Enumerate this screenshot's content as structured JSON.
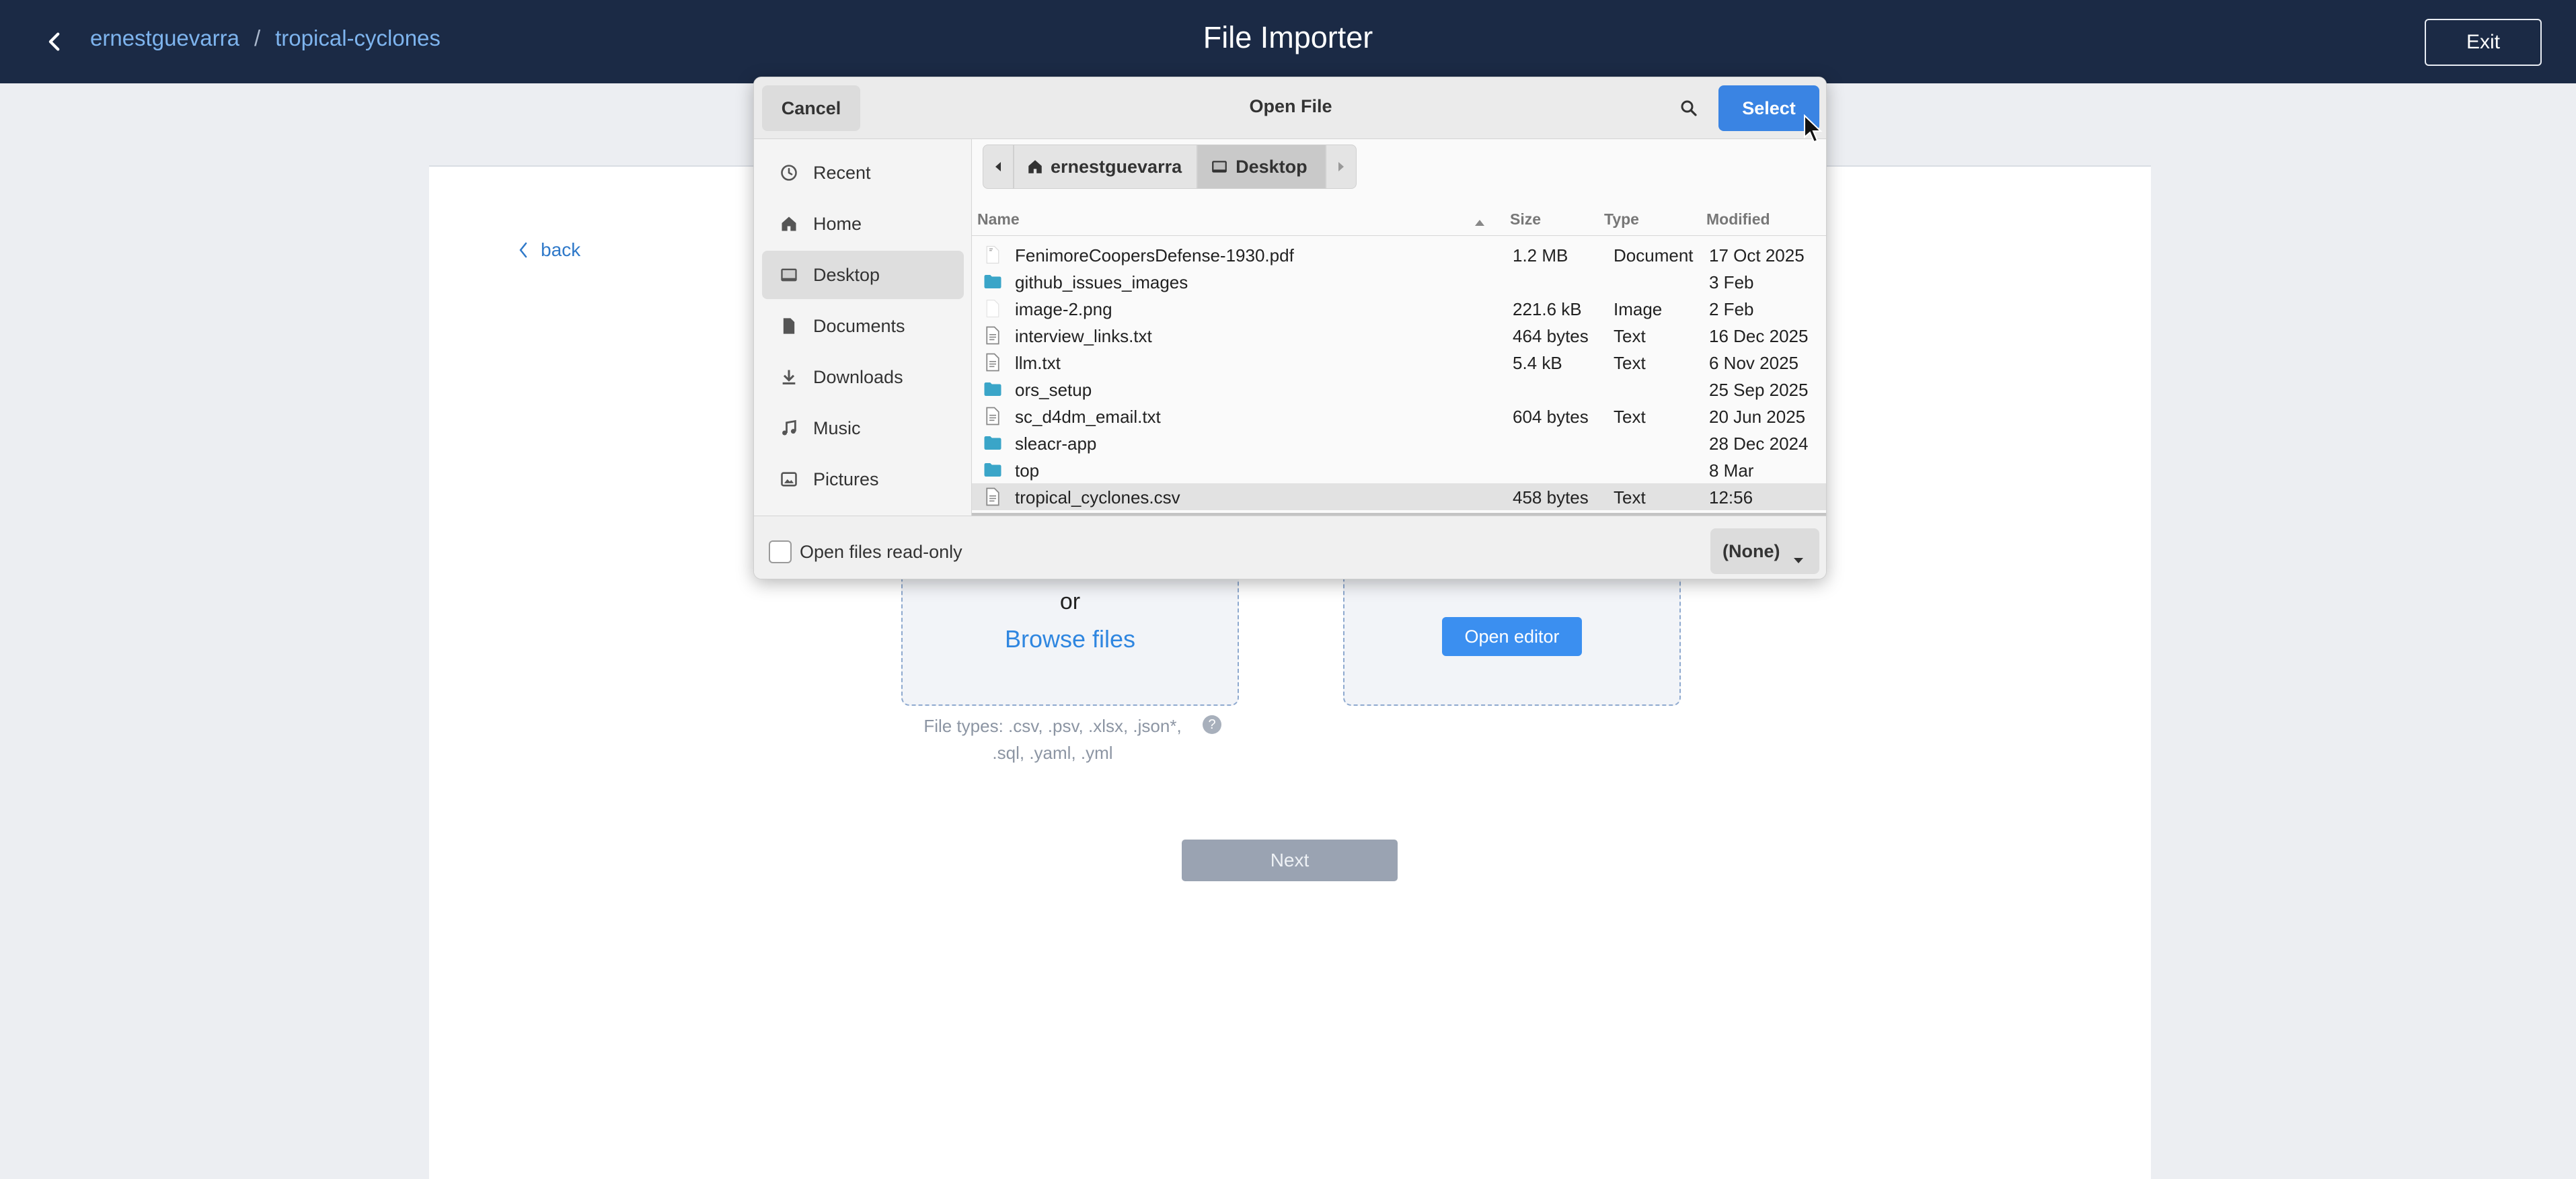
{
  "header": {
    "breadcrumb": [
      "ernestguevarra",
      "tropical-cyclones"
    ],
    "breadcrumb_sep": "/",
    "title": "File Importer",
    "exit_label": "Exit"
  },
  "page": {
    "back_label": "back",
    "or_label": "or",
    "browse_label": "Browse files",
    "open_editor_label": "Open editor",
    "file_types_line1": "File types: .csv, .psv, .xlsx, .json*,",
    "file_types_line2": ".sql, .yaml, .yml",
    "help_glyph": "?",
    "next_label": "Next"
  },
  "dialog": {
    "title": "Open File",
    "cancel_label": "Cancel",
    "select_label": "Select",
    "places": [
      {
        "label": "Recent",
        "icon": "clock-icon"
      },
      {
        "label": "Home",
        "icon": "home-icon"
      },
      {
        "label": "Desktop",
        "icon": "desktop-icon",
        "active": true
      },
      {
        "label": "Documents",
        "icon": "document-icon"
      },
      {
        "label": "Downloads",
        "icon": "download-icon"
      },
      {
        "label": "Music",
        "icon": "music-icon"
      },
      {
        "label": "Pictures",
        "icon": "pictures-icon"
      }
    ],
    "path": [
      "ernestguevarra",
      "Desktop"
    ],
    "columns": {
      "name": "Name",
      "size": "Size",
      "type": "Type",
      "modified": "Modified"
    },
    "files": [
      {
        "name": "FenimoreCoopersDefense-1930.pdf",
        "size": "1.2 MB",
        "type": "Document",
        "modified": "17 Oct 2025",
        "kind": "file"
      },
      {
        "name": "github_issues_images",
        "size": "",
        "type": "",
        "modified": "3 Feb",
        "kind": "folder"
      },
      {
        "name": "image-2.png",
        "size": "221.6 kB",
        "type": "Image",
        "modified": "2 Feb",
        "kind": "image"
      },
      {
        "name": "interview_links.txt",
        "size": "464 bytes",
        "type": "Text",
        "modified": "16 Dec 2025",
        "kind": "text"
      },
      {
        "name": "llm.txt",
        "size": "5.4 kB",
        "type": "Text",
        "modified": "6 Nov 2025",
        "kind": "text"
      },
      {
        "name": "ors_setup",
        "size": "",
        "type": "",
        "modified": "25 Sep 2025",
        "kind": "folder"
      },
      {
        "name": "sc_d4dm_email.txt",
        "size": "604 bytes",
        "type": "Text",
        "modified": "20 Jun 2025",
        "kind": "text"
      },
      {
        "name": "sleacr-app",
        "size": "",
        "type": "",
        "modified": "28 Dec 2024",
        "kind": "folder"
      },
      {
        "name": "top",
        "size": "",
        "type": "",
        "modified": "8 Mar",
        "kind": "folder"
      },
      {
        "name": "tropical_cyclones.csv",
        "size": "458 bytes",
        "type": "Text",
        "modified": "12:56",
        "kind": "text",
        "selected": true
      }
    ],
    "readonly_label": "Open files read-only",
    "readonly_checked": false,
    "filter_value": "(None)"
  },
  "colors": {
    "header_bg": "#1b2a45",
    "accent": "#3a84e3",
    "link": "#7eb4ee",
    "folder": "#3aa5c8"
  }
}
